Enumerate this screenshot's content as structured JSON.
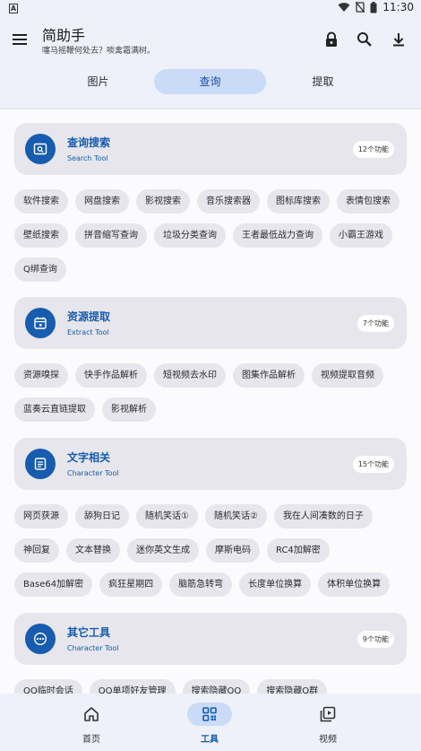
{
  "status_bar": {
    "time": "11:30"
  },
  "header": {
    "title": "简助手",
    "subtitle": "噻马摇鞭何处去？啖禽霜满树。"
  },
  "tabs": [
    {
      "label": "图片",
      "active": false
    },
    {
      "label": "查询",
      "active": true
    },
    {
      "label": "提取",
      "active": false
    }
  ],
  "sections": [
    {
      "title": "查询搜索",
      "subtitle": "Search Tool",
      "count": "12个功能",
      "icon": "search-window-icon",
      "items": [
        "软件搜索",
        "网盘搜索",
        "影视搜索",
        "音乐搜索器",
        "图标库搜索",
        "表情包搜索",
        "壁纸搜索",
        "拼音缩写查询",
        "垃圾分类查询",
        "王者最低战力查询",
        "小霸王游戏",
        "Q绑查询"
      ]
    },
    {
      "title": "资源提取",
      "subtitle": "Extract Tool",
      "count": "7个功能",
      "icon": "calendar-icon",
      "items": [
        "资源嗅探",
        "快手作品解析",
        "短视频去水印",
        "图集作品解析",
        "视频提取音频",
        "蓝奏云直链提取",
        "影视解析"
      ]
    },
    {
      "title": "文字相关",
      "subtitle": "Character Tool",
      "count": "15个功能",
      "icon": "document-icon",
      "items": [
        "网页获源",
        "舔狗日记",
        "随机笑话①",
        "随机笑话②",
        "我在人间凑数的日子",
        "神回复",
        "文本替换",
        "迷你英文生成",
        "摩斯电码",
        "RC4加解密",
        "Base64加解密",
        "疯狂星期四",
        "脑筋急转弯",
        "长度单位换算",
        "体积单位换算"
      ]
    },
    {
      "title": "其它工具",
      "subtitle": "Character Tool",
      "count": "9个功能",
      "icon": "more-dots-icon",
      "items": [
        "QQ临时会话",
        "QQ单项好友管理",
        "搜索隐藏QQ",
        "搜索隐藏Q群"
      ]
    }
  ],
  "bottom_nav": [
    {
      "label": "首页",
      "icon": "home-icon",
      "active": false
    },
    {
      "label": "工具",
      "icon": "grid-icon",
      "active": true
    },
    {
      "label": "视频",
      "icon": "video-library-icon",
      "active": false
    }
  ],
  "colors": {
    "accent": "#175cae",
    "accent_light": "#c9dbf7",
    "chip_bg": "#e6e6ec",
    "bar_bg": "#eef1fa"
  }
}
